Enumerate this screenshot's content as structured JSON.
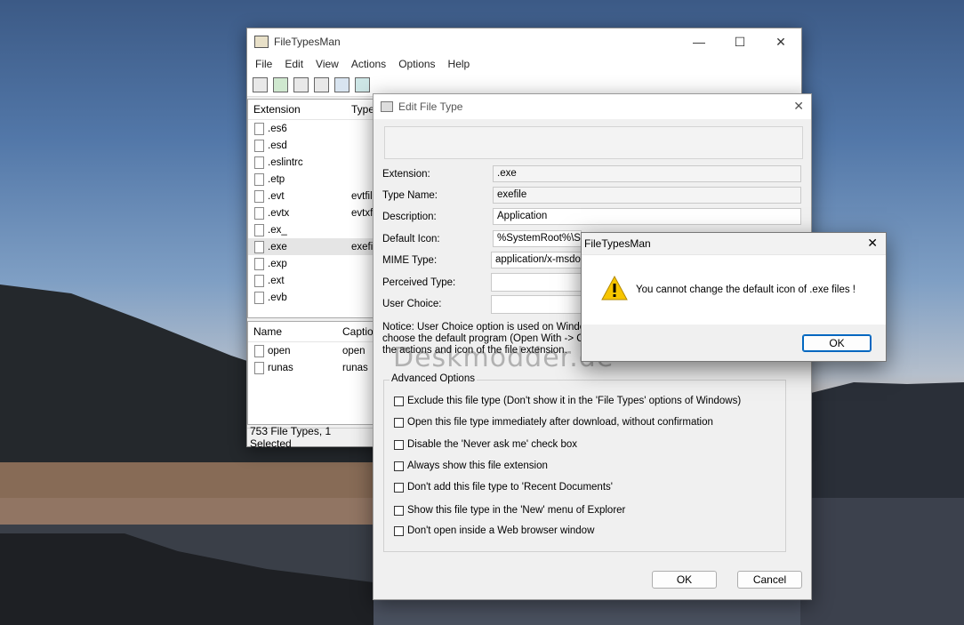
{
  "main_window": {
    "title": "FileTypesMan",
    "menu": [
      "File",
      "Edit",
      "View",
      "Actions",
      "Options",
      "Help"
    ],
    "toolbar_icons": [
      "save-icon",
      "refresh-icon",
      "copy-icon",
      "properties-icon",
      "find-icon",
      "exit-icon"
    ],
    "list": {
      "columns": [
        "Extension",
        "Type"
      ],
      "rows": [
        {
          "ext": ".es6",
          "type": ""
        },
        {
          "ext": ".esd",
          "type": ""
        },
        {
          "ext": ".eslintrc",
          "type": ""
        },
        {
          "ext": ".etp",
          "type": ""
        },
        {
          "ext": ".evt",
          "type": "evtfil"
        },
        {
          "ext": ".evtx",
          "type": "evtxf"
        },
        {
          "ext": ".ex_",
          "type": ""
        },
        {
          "ext": ".exe",
          "type": "exefi"
        },
        {
          "ext": ".exp",
          "type": ""
        },
        {
          "ext": ".ext",
          "type": ""
        },
        {
          "ext": ".evb",
          "type": ""
        }
      ]
    },
    "actions_list": {
      "columns": [
        "Name",
        "Captio"
      ],
      "rows": [
        {
          "name": "open",
          "caption": "open"
        },
        {
          "name": "runas",
          "caption": "runas"
        }
      ]
    },
    "status": "753 File Types, 1 Selected"
  },
  "edit_dialog": {
    "title": "Edit File Type",
    "fields": {
      "extension_label": "Extension:",
      "extension_value": ".exe",
      "type_name_label": "Type Name:",
      "type_name_value": "exefile",
      "description_label": "Description:",
      "description_value": "Application",
      "default_icon_label": "Default Icon:",
      "default_icon_value": "%SystemRoot%\\Sy",
      "mime_label": "MIME Type:",
      "mime_value": "application/x-msdow",
      "perceived_label": "Perceived Type:",
      "perceived_value": "",
      "user_choice_label": "User Choice:",
      "user_choice_value": ""
    },
    "notice_lines": [
      "Notice: User Choice option is used on Windows",
      "choose the default program (Open With -> Ch",
      "the actions and icon of the file extension."
    ],
    "advanced_label": "Advanced Options",
    "options": [
      "Exclude  this file type (Don't show it in the 'File Types' options of Windows)",
      "Open this file type immediately after download, without confirmation",
      "Disable the 'Never ask me' check box",
      "Always show this file extension",
      "Don't add this file type to 'Recent Documents'",
      "Show this file type in the 'New' menu of Explorer",
      "Don't open inside a Web browser window"
    ],
    "ok": "OK",
    "cancel": "Cancel"
  },
  "message_box": {
    "title": "FileTypesMan",
    "text": "You cannot change the default icon of .exe files !",
    "ok": "OK"
  },
  "watermark": "Deskmodder.de"
}
